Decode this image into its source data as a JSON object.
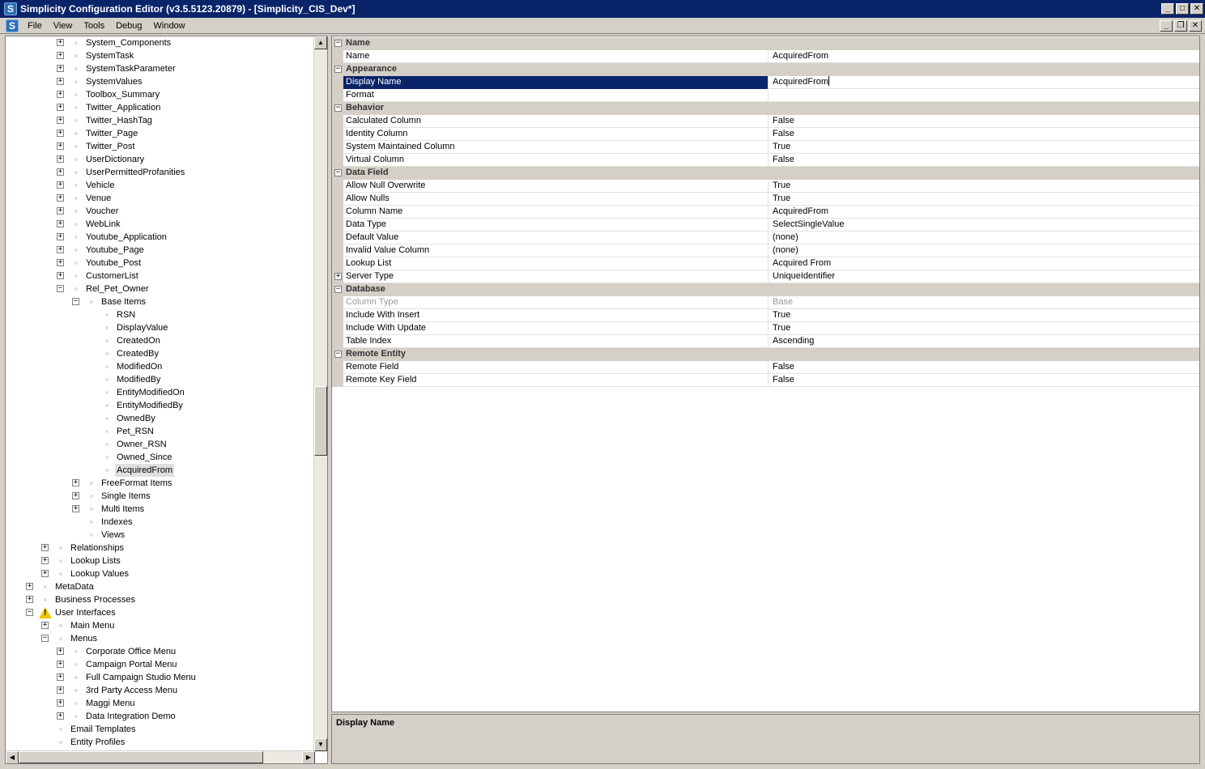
{
  "window": {
    "title": "Simplicity Configuration Editor (v3.5.5123.20879) - [Simplicity_CIS_Dev*]",
    "app_icon": "S",
    "minimize": "_",
    "maximize": "□",
    "close": "✕"
  },
  "menu": {
    "items": [
      "File",
      "View",
      "Tools",
      "Debug",
      "Window"
    ],
    "mdi_minimize": "_",
    "mdi_restore": "❐",
    "mdi_close": "✕"
  },
  "tree": {
    "rows": [
      {
        "label": "System_Components",
        "level": 3,
        "expander": "+"
      },
      {
        "label": "SystemTask",
        "level": 3,
        "expander": "+"
      },
      {
        "label": "SystemTaskParameter",
        "level": 3,
        "expander": "+"
      },
      {
        "label": "SystemValues",
        "level": 3,
        "expander": "+"
      },
      {
        "label": "Toolbox_Summary",
        "level": 3,
        "expander": "+"
      },
      {
        "label": "Twitter_Application",
        "level": 3,
        "expander": "+"
      },
      {
        "label": "Twitter_HashTag",
        "level": 3,
        "expander": "+"
      },
      {
        "label": "Twitter_Page",
        "level": 3,
        "expander": "+"
      },
      {
        "label": "Twitter_Post",
        "level": 3,
        "expander": "+"
      },
      {
        "label": "UserDictionary",
        "level": 3,
        "expander": "+"
      },
      {
        "label": "UserPermittedProfanities",
        "level": 3,
        "expander": "+"
      },
      {
        "label": "Vehicle",
        "level": 3,
        "expander": "+"
      },
      {
        "label": "Venue",
        "level": 3,
        "expander": "+"
      },
      {
        "label": "Voucher",
        "level": 3,
        "expander": "+"
      },
      {
        "label": "WebLink",
        "level": 3,
        "expander": "+"
      },
      {
        "label": "Youtube_Application",
        "level": 3,
        "expander": "+"
      },
      {
        "label": "Youtube_Page",
        "level": 3,
        "expander": "+"
      },
      {
        "label": "Youtube_Post",
        "level": 3,
        "expander": "+"
      },
      {
        "label": "CustomerList",
        "level": 3,
        "expander": "+"
      },
      {
        "label": "Rel_Pet_Owner",
        "level": 3,
        "expander": "−"
      },
      {
        "label": "Base Items",
        "level": 4,
        "expander": "−"
      },
      {
        "label": "RSN",
        "level": 5,
        "expander": ""
      },
      {
        "label": "DisplayValue",
        "level": 5,
        "expander": ""
      },
      {
        "label": "CreatedOn",
        "level": 5,
        "expander": ""
      },
      {
        "label": "CreatedBy",
        "level": 5,
        "expander": ""
      },
      {
        "label": "ModifiedOn",
        "level": 5,
        "expander": ""
      },
      {
        "label": "ModifiedBy",
        "level": 5,
        "expander": ""
      },
      {
        "label": "EntityModifiedOn",
        "level": 5,
        "expander": ""
      },
      {
        "label": "EntityModifiedBy",
        "level": 5,
        "expander": ""
      },
      {
        "label": "OwnedBy",
        "level": 5,
        "expander": ""
      },
      {
        "label": "Pet_RSN",
        "level": 5,
        "expander": ""
      },
      {
        "label": "Owner_RSN",
        "level": 5,
        "expander": ""
      },
      {
        "label": "Owned_Since",
        "level": 5,
        "expander": ""
      },
      {
        "label": "AcquiredFrom",
        "level": 5,
        "expander": "",
        "selected": true
      },
      {
        "label": "FreeFormat Items",
        "level": 4,
        "expander": "+"
      },
      {
        "label": "Single Items",
        "level": 4,
        "expander": "+"
      },
      {
        "label": "Multi Items",
        "level": 4,
        "expander": "+"
      },
      {
        "label": "Indexes",
        "level": 4,
        "expander": ""
      },
      {
        "label": "Views",
        "level": 4,
        "expander": ""
      },
      {
        "label": "Relationships",
        "level": 2,
        "expander": "+"
      },
      {
        "label": "Lookup Lists",
        "level": 2,
        "expander": "+"
      },
      {
        "label": "Lookup Values",
        "level": 2,
        "expander": "+"
      },
      {
        "label": "MetaData",
        "level": 1,
        "expander": "+"
      },
      {
        "label": "Business Processes",
        "level": 1,
        "expander": "+"
      },
      {
        "label": "User Interfaces",
        "level": 1,
        "expander": "−",
        "warning": true
      },
      {
        "label": "Main Menu",
        "level": 2,
        "expander": "+"
      },
      {
        "label": "Menus",
        "level": 2,
        "expander": "−"
      },
      {
        "label": "Corporate Office Menu",
        "level": 3,
        "expander": "+"
      },
      {
        "label": "Campaign Portal Menu",
        "level": 3,
        "expander": "+"
      },
      {
        "label": "Full Campaign Studio Menu",
        "level": 3,
        "expander": "+"
      },
      {
        "label": "3rd Party Access Menu",
        "level": 3,
        "expander": "+"
      },
      {
        "label": "Maggi Menu",
        "level": 3,
        "expander": "+"
      },
      {
        "label": "Data Integration Demo",
        "level": 3,
        "expander": "+"
      },
      {
        "label": "Email Templates",
        "level": 2,
        "expander": ""
      },
      {
        "label": "Entity Profiles",
        "level": 2,
        "expander": ""
      }
    ],
    "scroll_up": "▲",
    "scroll_down": "▼",
    "scroll_left": "◀",
    "scroll_right": "▶"
  },
  "property_grid": {
    "rows": [
      {
        "type": "category",
        "label": "Name"
      },
      {
        "type": "prop",
        "name": "Name",
        "value": "AcquiredFrom"
      },
      {
        "type": "category",
        "label": "Appearance"
      },
      {
        "type": "prop",
        "name": "Display Name",
        "value": "AcquiredFrom",
        "selected": true
      },
      {
        "type": "prop",
        "name": "Format",
        "value": ""
      },
      {
        "type": "category",
        "label": "Behavior"
      },
      {
        "type": "prop",
        "name": "Calculated Column",
        "value": "False"
      },
      {
        "type": "prop",
        "name": "Identity Column",
        "value": "False"
      },
      {
        "type": "prop",
        "name": "System Maintained Column",
        "value": "True"
      },
      {
        "type": "prop",
        "name": "Virtual Column",
        "value": "False"
      },
      {
        "type": "category",
        "label": "Data Field"
      },
      {
        "type": "prop",
        "name": "Allow Null Overwrite",
        "value": "True"
      },
      {
        "type": "prop",
        "name": "Allow Nulls",
        "value": "True"
      },
      {
        "type": "prop",
        "name": "Column Name",
        "value": "AcquiredFrom"
      },
      {
        "type": "prop",
        "name": "Data Type",
        "value": "SelectSingleValue"
      },
      {
        "type": "prop",
        "name": "Default Value",
        "value": "(none)"
      },
      {
        "type": "prop",
        "name": "Invalid Value Column",
        "value": "(none)"
      },
      {
        "type": "prop",
        "name": "Lookup List",
        "value": "Acquired From"
      },
      {
        "type": "prop",
        "name": "Server Type",
        "value": "UniqueIdentifier",
        "expandable": true
      },
      {
        "type": "category",
        "label": "Database"
      },
      {
        "type": "prop",
        "name": "Column Type",
        "value": "Base",
        "disabled": true
      },
      {
        "type": "prop",
        "name": "Include With Insert",
        "value": "True"
      },
      {
        "type": "prop",
        "name": "Include With Update",
        "value": "True"
      },
      {
        "type": "prop",
        "name": "Table Index",
        "value": "Ascending"
      },
      {
        "type": "category",
        "label": "Remote Entity"
      },
      {
        "type": "prop",
        "name": "Remote Field",
        "value": "False"
      },
      {
        "type": "prop",
        "name": "Remote Key Field",
        "value": "False"
      }
    ],
    "category_expander": "−",
    "sub_expander": "+"
  },
  "description": {
    "title": "Display Name"
  },
  "colors": {
    "title_bar": "#0a246a",
    "selection": "#0a246a",
    "face": "#d4d0c8"
  }
}
